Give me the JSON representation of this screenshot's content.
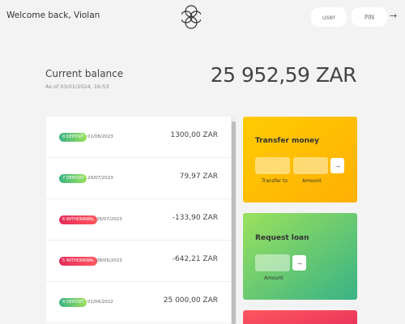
{
  "nav": {
    "welcome": "Welcome back, Violan",
    "user_placeholder": "user",
    "pin_placeholder": "PIN",
    "login_arrow": "→"
  },
  "balance": {
    "label": "Current balance",
    "date": "As of 03/01/2024, 16:53",
    "value": "25 952,59 ZAR"
  },
  "movements": [
    {
      "type": "8 DEPOSIT",
      "kind": "deposit",
      "date": "01/08/2023",
      "value": "1300,00 ZAR"
    },
    {
      "type": "7 DEPOSIT",
      "kind": "deposit",
      "date": "29/07/2023",
      "value": "79,97 ZAR"
    },
    {
      "type": "6 WITHDRAWAL",
      "kind": "withdrawal",
      "date": "26/07/2023",
      "value": "-133,90 ZAR"
    },
    {
      "type": "5 WITHDRAWAL",
      "kind": "withdrawal",
      "date": "08/05/2023",
      "value": "-642,21 ZAR"
    },
    {
      "type": "4 DEPOSIT",
      "kind": "deposit",
      "date": "01/04/2022",
      "value": "25 000,00 ZAR"
    }
  ],
  "transfer": {
    "title": "Transfer money",
    "to_label": "Transfer to",
    "amount_label": "Amount",
    "button": "→"
  },
  "loan": {
    "title": "Request loan",
    "amount_label": "Amount",
    "button": "→"
  },
  "colors": {
    "deposit": "#39b385",
    "withdrawal": "#e52a5a",
    "transfer": "#ffb003",
    "loan": "#9be15d"
  }
}
